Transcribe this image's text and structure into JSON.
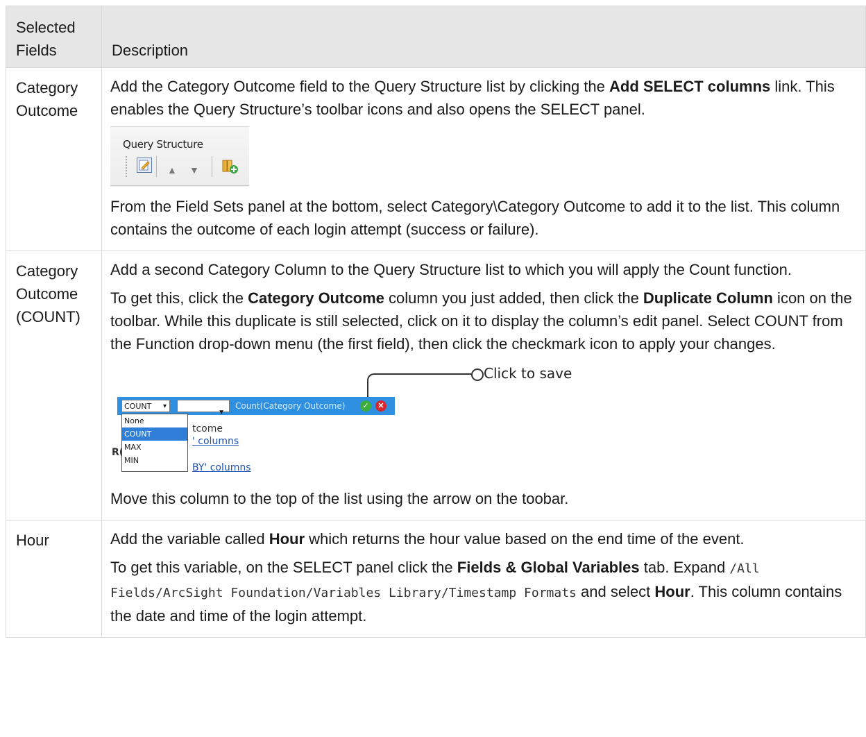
{
  "header": {
    "fields_label": "Selected Fields",
    "description_label": "Description"
  },
  "rows": [
    {
      "field": "Category Outcome",
      "p1_a": "Add the Category Outcome field to the Query Structure list by clicking the ",
      "p1_b": "Add SELECT columns",
      "p1_c": " link. This enables the Query Structure’s toolbar icons and also opens the SELECT panel.",
      "image": {
        "title": "Query Structure"
      },
      "p2": "From the Field Sets panel at the bottom, select Category\\Category Outcome to add it to the list. This column contains the outcome of each login attempt (success or failure)."
    },
    {
      "field": "Category Outcome (COUNT)",
      "p1": "Add a second Category Column to the Query Structure list to which you will apply the Count function.",
      "p2_a": "To get this, click the ",
      "p2_b": "Category Outcome",
      "p2_c": " column you just added, then click the ",
      "p2_d": "Duplicate Column",
      "p2_e": " icon on the toolbar. While this duplicate is still selected, click on it to display the column’s edit panel. Select COUNT from the Function drop-down menu (the first field), then click the checkmark icon to apply your changes.",
      "image": {
        "callout": "Click to save",
        "function_value": "COUNT",
        "column_label": "Count(Category Outcome)",
        "options": [
          "None",
          "COUNT",
          "MAX",
          "MIN"
        ],
        "selected_option": "COUNT",
        "bg_text_1": "tcome",
        "bg_text_2": "' columns",
        "bg_text_3": "BY' columns",
        "bg_text_4": "R("
      },
      "p3": "Move this column to the top of the list using the arrow on the toobar."
    },
    {
      "field": "Hour",
      "p1_a": "Add the variable called ",
      "p1_b": "Hour",
      "p1_c": " which returns the hour value based on the end time of the event.",
      "p2_a": "To get this variable, on the SELECT panel click the ",
      "p2_b": "Fields & Global Variables",
      "p2_c": " tab. Expand ",
      "p2_code": "/All Fields/ArcSight Foundation/Variables Library/Timestamp Formats",
      "p2_d": " and select ",
      "p2_e": "Hour",
      "p2_f": ". This column contains the date and time of the login attempt."
    }
  ]
}
